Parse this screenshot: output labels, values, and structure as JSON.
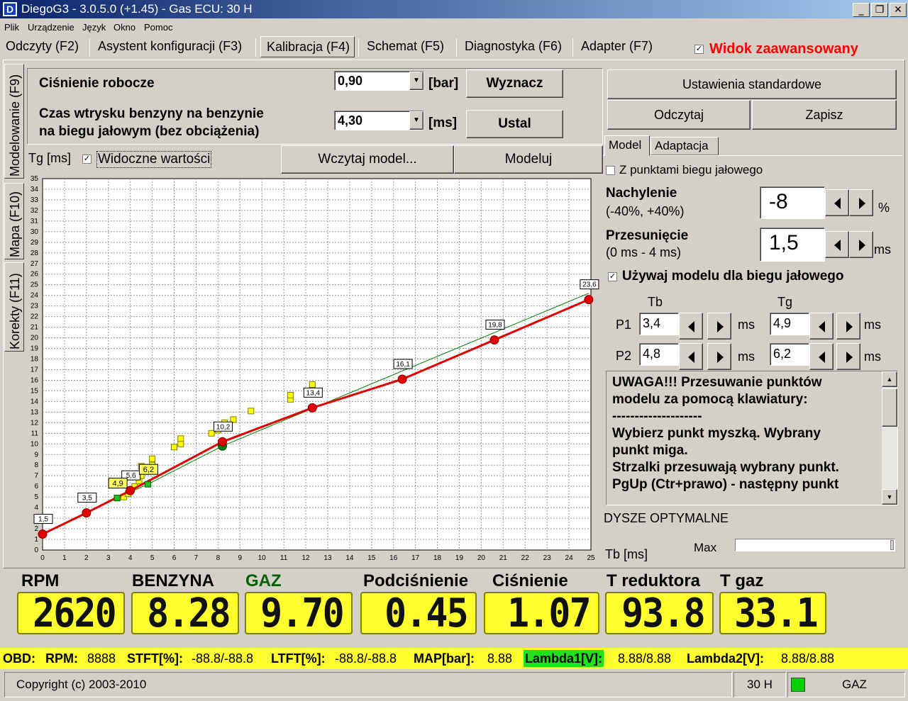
{
  "window": {
    "title": "DiegoG3 - 3.0.5.0 (+1.45) - Gas ECU: 30 H",
    "icon_letter": "D",
    "controls": [
      "minimize-icon",
      "restore-icon",
      "close-icon"
    ]
  },
  "menu": [
    "Plik",
    "Urządzenie",
    "Język",
    "Okno",
    "Pomoc"
  ],
  "tabs": [
    "Odczyty (F2)",
    "Asystent konfiguracji (F3)",
    "Kalibracja (F4)",
    "Schemat (F5)",
    "Diagnostyka (F6)",
    "Adapter (F7)"
  ],
  "active_tab": "Kalibracja (F4)",
  "advanced_view": {
    "label": "Widok zaawansowany",
    "checked": true,
    "color": "#ff0000"
  },
  "side_tabs": [
    "Modelowanie (F9)",
    "Mapa (F10)",
    "Korekty (F11)"
  ],
  "calibration": {
    "pressure_label": "Ciśnienie robocze",
    "pressure_value": "0,90",
    "pressure_unit": "[bar]",
    "determine_button": "Wyznacz",
    "injection_label_1": "Czas wtrysku benzyny na benzynie",
    "injection_label_2": "na biegu jałowym (bez obciążenia)",
    "injection_value": "4,30",
    "injection_unit": "[ms]",
    "set_button": "Ustal"
  },
  "chart_controls": {
    "y_axis_label": "Tg [ms]",
    "visible_values_label": "Widoczne wartości",
    "visible_values_checked": true,
    "load_model_button": "Wczytaj model...",
    "model_button": "Modeluj"
  },
  "right_panel": {
    "standard_settings_button": "Ustawienia standardowe",
    "read_button": "Odczytaj",
    "save_button": "Zapisz",
    "subtabs": [
      "Model",
      "Adaptacja"
    ],
    "idle_points_label": "Z punktami biegu jałowego",
    "idle_points_checked": false,
    "slope_label": "Nachylenie",
    "slope_range": "(-40%, +40%)",
    "slope_value": "-8",
    "slope_unit": "%",
    "shift_label": "Przesunięcie",
    "shift_range": "(0 ms - 4 ms)",
    "shift_value": "1,5",
    "shift_unit": "ms",
    "use_model_idle_label": "Używaj modelu dla biegu jałowego",
    "use_model_idle_checked": true,
    "tb_header": "Tb",
    "tg_header": "Tg",
    "p1_label": "P1",
    "p2_label": "P2",
    "p1_tb": "3,4",
    "p1_tg": "4,9",
    "p2_tb": "4,8",
    "p2_tg": "6,2",
    "ms_unit": "ms",
    "warning_lines": [
      "UWAGA!!! Przesuwanie punktów",
      "modelu za pomocą klawiatury:",
      "--------------------",
      "Wybierz punkt myszką. Wybrany",
      "punkt miga.",
      "Strzalki przesuwają wybrany punkt.",
      "PgUp (Ctr+prawo) - następny punkt"
    ],
    "optimal_nozzles_label": "DYSZE OPTYMALNE",
    "tb_ms_label": "Tb [ms]",
    "max_label": "Max"
  },
  "chart_data": {
    "type": "line",
    "xlabel": "",
    "ylabel": "Tg [ms]",
    "xlim": [
      0,
      25
    ],
    "ylim": [
      0,
      35
    ],
    "xticks": [
      0,
      1,
      2,
      3,
      4,
      5,
      6,
      7,
      8,
      9,
      10,
      11,
      12,
      13,
      14,
      15,
      16,
      17,
      18,
      19,
      20,
      21,
      22,
      23,
      24,
      25
    ],
    "yticks": [
      0,
      1,
      2,
      3,
      4,
      5,
      6,
      7,
      8,
      9,
      10,
      11,
      12,
      13,
      14,
      15,
      16,
      17,
      18,
      19,
      20,
      21,
      22,
      23,
      24,
      25,
      26,
      27,
      28,
      29,
      30,
      31,
      32,
      33,
      34,
      35
    ],
    "grid": true,
    "model_curve": {
      "color": "#e00000",
      "points": [
        [
          0,
          1.5
        ],
        [
          2,
          3.5
        ],
        [
          4,
          5.6
        ],
        [
          8.2,
          10.2
        ],
        [
          12.3,
          13.4
        ],
        [
          16.4,
          16.1
        ],
        [
          20.6,
          19.8
        ],
        [
          24.9,
          23.6
        ]
      ],
      "labels": [
        "1,5",
        "3,5",
        "5,6",
        "10,2",
        "13,4",
        "16,1",
        "19,8",
        "23,6"
      ]
    },
    "base_line": {
      "color": "#008000",
      "points": [
        [
          3.4,
          4.9
        ],
        [
          4.8,
          6.2
        ],
        [
          8.2,
          9.8
        ],
        [
          24.9,
          24.2
        ]
      ]
    },
    "yellow_labels": [
      {
        "x": 3.4,
        "y": 4.9,
        "text": "4,9"
      },
      {
        "x": 4.8,
        "y": 6.2,
        "text": "6,2"
      }
    ],
    "green_points": [
      [
        3.4,
        4.9
      ],
      [
        4.8,
        6.2
      ],
      [
        8.2,
        9.8
      ]
    ],
    "measured_points": [
      [
        3.4,
        4.9
      ],
      [
        3.7,
        5.0
      ],
      [
        3.9,
        5.3
      ],
      [
        4.0,
        5.6
      ],
      [
        4.2,
        6.0
      ],
      [
        4.4,
        6.5
      ],
      [
        4.5,
        7.0
      ],
      [
        4.7,
        7.4
      ],
      [
        4.5,
        7.9
      ],
      [
        5.0,
        8.0
      ],
      [
        5.0,
        8.6
      ],
      [
        6.0,
        9.7
      ],
      [
        6.3,
        10.0
      ],
      [
        6.3,
        10.5
      ],
      [
        7.7,
        11.0
      ],
      [
        8.0,
        11.3
      ],
      [
        8.3,
        12.0
      ],
      [
        8.7,
        12.3
      ],
      [
        9.5,
        13.1
      ],
      [
        11.3,
        14.2
      ],
      [
        11.3,
        14.6
      ],
      [
        12.3,
        15.3
      ],
      [
        12.3,
        15.6
      ]
    ]
  },
  "gauges": [
    {
      "label": "RPM",
      "value": "2620",
      "label_color": "#000000"
    },
    {
      "label": "BENZYNA",
      "value": "8.28",
      "label_color": "#000000"
    },
    {
      "label": "GAZ",
      "value": "9.70",
      "label_color": "#006000"
    },
    {
      "label": "Podciśnienie",
      "value": "0.45",
      "label_color": "#000000"
    },
    {
      "label": "Ciśnienie",
      "value": "1.07",
      "label_color": "#000000"
    },
    {
      "label": "T reduktora",
      "value": "93.8",
      "label_color": "#000000"
    },
    {
      "label": "T gaz",
      "value": "33.1",
      "label_color": "#000000"
    }
  ],
  "obd": {
    "prefix": "OBD:",
    "rpm_label": "RPM:",
    "rpm_value": "8888",
    "stft_label": "STFT[%]:",
    "stft_value": "-88.8/-88.8",
    "ltft_label": "LTFT[%]:",
    "ltft_value": "-88.8/-88.8",
    "map_label": "MAP[bar]:",
    "map_value": "8.88",
    "lambda1_label": "Lambda1[V]:",
    "lambda1_value": "8.88/8.88",
    "lambda2_label": "Lambda2[V]:",
    "lambda2_value": "8.88/8.88"
  },
  "status_bar": {
    "copyright": "Copyright (c) 2003-2010",
    "ecu": "30 H",
    "fuel": "GAZ",
    "fuel_indicator_color": "#00d000"
  }
}
